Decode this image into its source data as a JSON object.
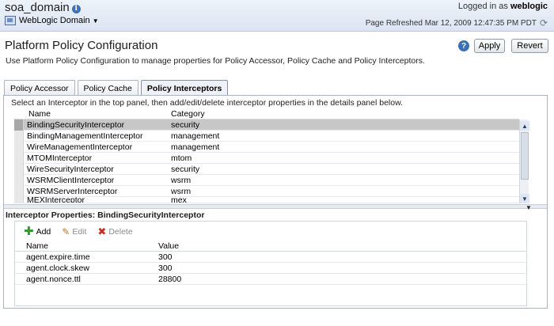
{
  "header": {
    "domain_title": "soa_domain",
    "domain_menu_label": "WebLogic Domain",
    "logged_in_prefix": "Logged in as",
    "logged_in_user": "weblogic",
    "page_refreshed": "Page Refreshed Mar 12, 2009 12:47:35 PM PDT"
  },
  "page": {
    "title": "Platform Policy Configuration",
    "description": "Use Platform Policy Configuration to manage properties for Policy Accessor, Policy Cache and Policy Interceptors.",
    "help_label": "?",
    "apply_label": "Apply",
    "revert_label": "Revert"
  },
  "tabs": [
    {
      "label": "Policy Accessor",
      "active": false
    },
    {
      "label": "Policy Cache",
      "active": false
    },
    {
      "label": "Policy Interceptors",
      "active": true
    }
  ],
  "interceptors": {
    "instruction": "Select an Interceptor in the top panel, then add/edit/delete interceptor properties in the details panel below.",
    "columns": {
      "name": "Name",
      "category": "Category"
    },
    "rows": [
      {
        "name": "BindingSecurityInterceptor",
        "category": "security",
        "selected": true
      },
      {
        "name": "BindingManagementInterceptor",
        "category": "management"
      },
      {
        "name": "WireManagementInterceptor",
        "category": "management"
      },
      {
        "name": "MTOMInterceptor",
        "category": "mtom"
      },
      {
        "name": "WireSecurityInterceptor",
        "category": "security"
      },
      {
        "name": "WSRMClientInterceptor",
        "category": "wsrm"
      },
      {
        "name": "WSRMServerInterceptor",
        "category": "wsrm"
      },
      {
        "name": "MEXInterceptor",
        "category": "mex"
      }
    ]
  },
  "properties": {
    "title": "Interceptor Properties: BindingSecurityInterceptor",
    "toolbar": {
      "add": "Add",
      "edit": "Edit",
      "delete": "Delete"
    },
    "columns": {
      "name": "Name",
      "value": "Value"
    },
    "rows": [
      {
        "name": "agent.expire.time",
        "value": "300"
      },
      {
        "name": "agent.clock.skew",
        "value": "300"
      },
      {
        "name": "agent.nonce.ttl",
        "value": "28800"
      }
    ]
  }
}
